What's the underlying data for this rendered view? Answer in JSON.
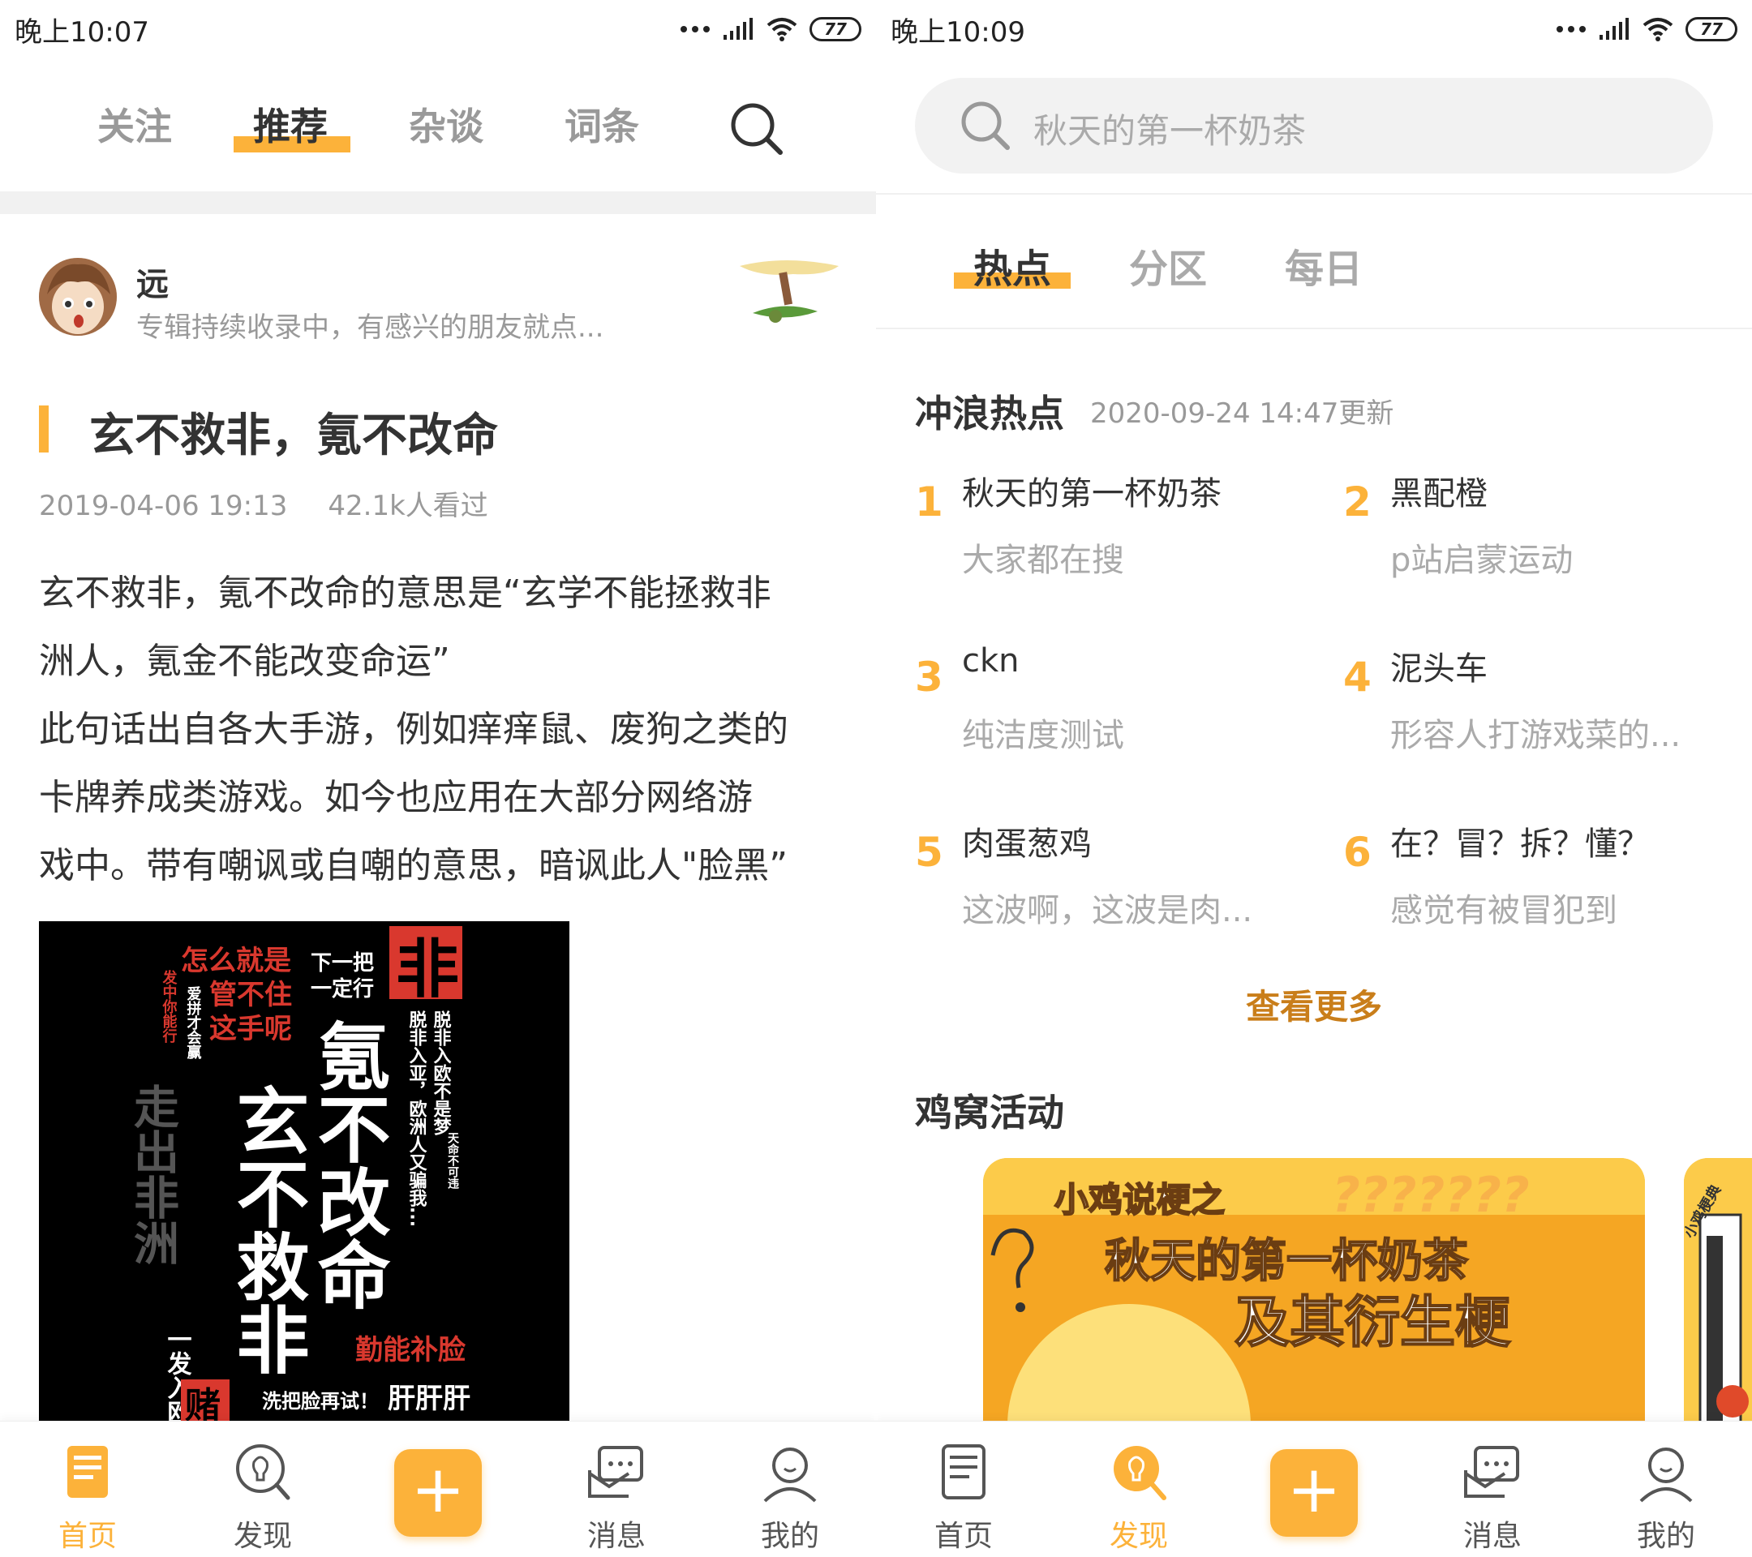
{
  "left": {
    "status": {
      "time": "晚上10:07",
      "battery": "77"
    },
    "tabs": [
      {
        "label": "关注"
      },
      {
        "label": "推荐"
      },
      {
        "label": "杂谈"
      },
      {
        "label": "词条"
      }
    ],
    "author": {
      "name": "远",
      "desc": "专辑持续收录中，有感兴的朋友就点..."
    },
    "article": {
      "title": "玄不救非，氪不改命",
      "date": "2019-04-06 19:13",
      "views": "42.1k人看过",
      "lines": [
        "玄不救非，氪不改命的意思是“玄学不能拯救非",
        "洲人，氪金不能改变命运”",
        "此句话出自各大手游，例如痒痒鼠、废狗之类的",
        "卡牌养成类游戏。如今也应用在大部分网络游",
        "戏中。带有嘲讽或自嘲的意思，暗讽此人\"脸黑”"
      ]
    },
    "image_text": {
      "t1": "怎么就是",
      "t2": "管不住",
      "t3": "这手呢",
      "t4": "下一把",
      "t5": "一定行",
      "t6": "非",
      "t7": "发中你能行",
      "t8": "爱拼才会赢",
      "t9": "脱非入欧不是梦",
      "t10": "脱非入亚，欧洲人又骗我...",
      "t11": "天命不可违",
      "t12": "走出非洲",
      "t13": "玄不救非",
      "t14": "氪不改命",
      "t15": "一发入欧",
      "t16": "勤能补脸",
      "t17": "洗把脸再试！",
      "t18": "肝肝肝",
      "t19": "赌"
    },
    "nav": [
      {
        "label": "首页"
      },
      {
        "label": "发现"
      },
      {
        "label": "+"
      },
      {
        "label": "消息"
      },
      {
        "label": "我的"
      }
    ]
  },
  "right": {
    "status": {
      "time": "晚上10:09",
      "battery": "77"
    },
    "search": {
      "placeholder": "秋天的第一杯奶茶"
    },
    "subtabs": [
      {
        "label": "热点"
      },
      {
        "label": "分区"
      },
      {
        "label": "每日"
      }
    ],
    "hot": {
      "title": "冲浪热点",
      "updated": "2020-09-24 14:47更新",
      "items": [
        {
          "rank": "1",
          "title": "秋天的第一杯奶茶",
          "sub": "大家都在搜"
        },
        {
          "rank": "2",
          "title": "黑配橙",
          "sub": "p站启蒙运动"
        },
        {
          "rank": "3",
          "title": "ckn",
          "sub": "纯洁度测试"
        },
        {
          "rank": "4",
          "title": "泥头车",
          "sub": "形容人打游戏菜的..."
        },
        {
          "rank": "5",
          "title": "肉蛋葱鸡",
          "sub": "这波啊，这波是肉..."
        },
        {
          "rank": "6",
          "title": "在？冒？拆？懂？",
          "sub": "感觉有被冒犯到"
        }
      ],
      "more": "查看更多"
    },
    "activity": {
      "title": "鸡窝活动",
      "banner_line1": "小鸡说梗之",
      "banner_line2": "秋天的第一杯奶茶",
      "banner_line3": "及其衍生梗",
      "banner_q": "???????",
      "next_text": "小鸡梗典"
    },
    "nav": [
      {
        "label": "首页"
      },
      {
        "label": "发现"
      },
      {
        "label": "+"
      },
      {
        "label": "消息"
      },
      {
        "label": "我的"
      }
    ]
  },
  "colors": {
    "accent": "#fcb23a",
    "more": "#c97e1a",
    "muted": "#999999"
  }
}
